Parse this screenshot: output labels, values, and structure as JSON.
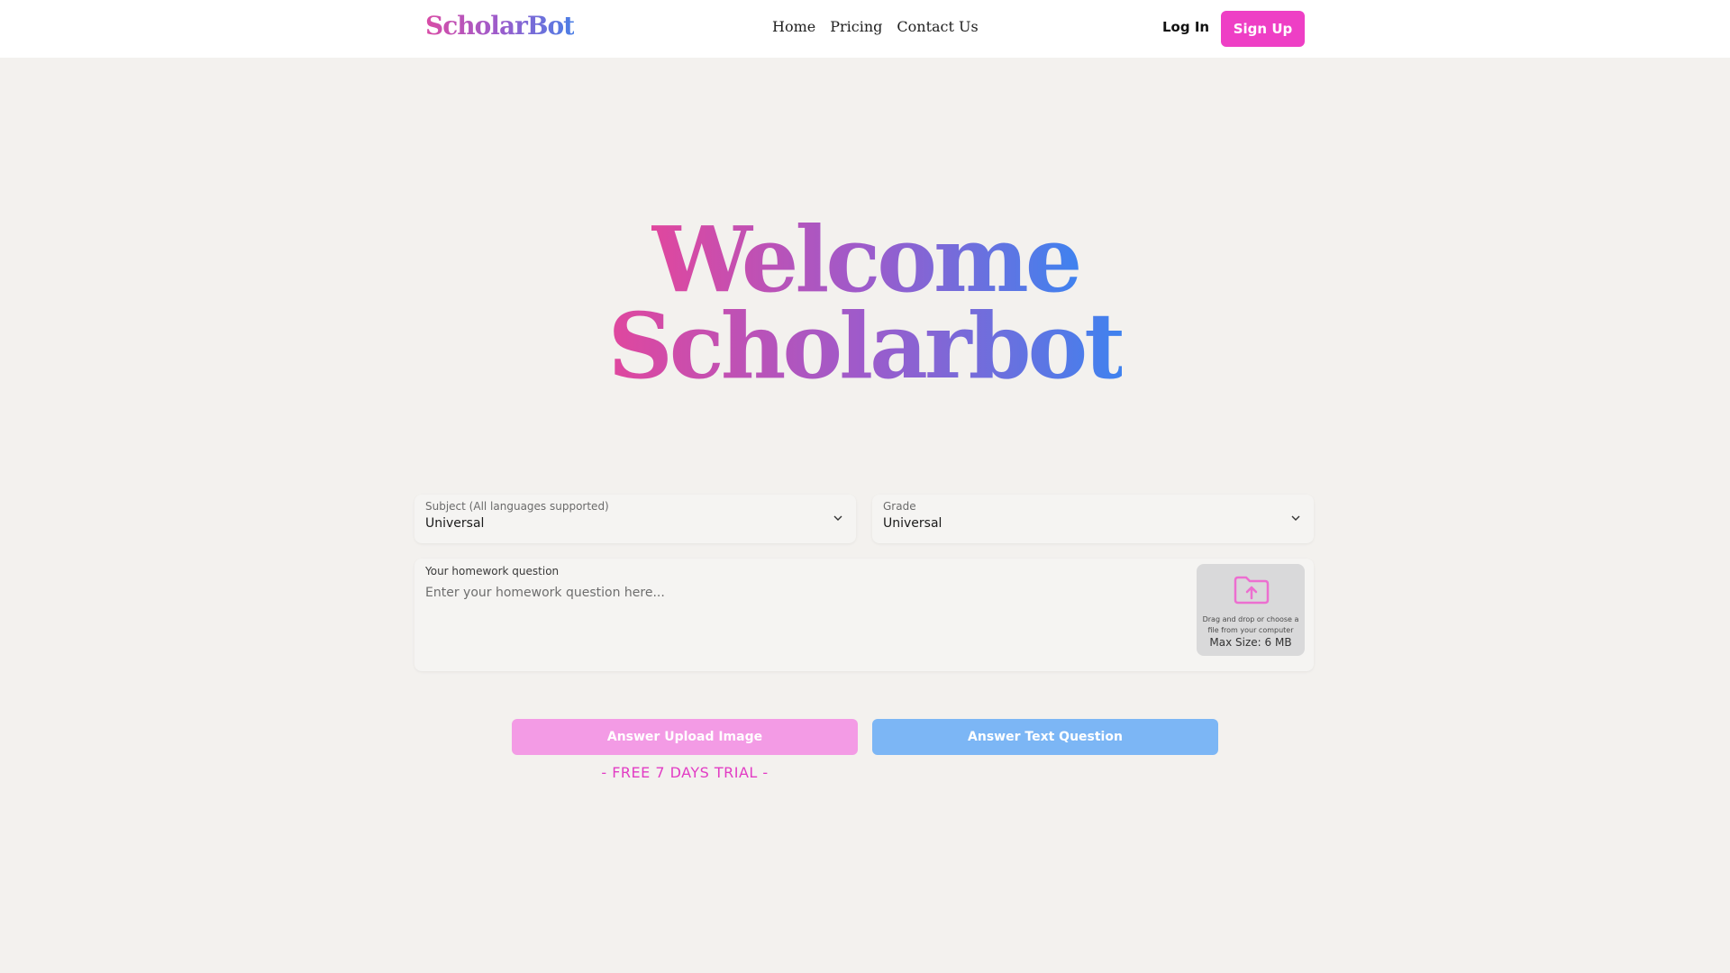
{
  "header": {
    "logo": "ScholarBot",
    "nav": [
      "Home",
      "Pricing",
      "Contact Us"
    ],
    "login_label": "Log In",
    "signup_label": "Sign Up"
  },
  "hero": {
    "line1": "Welcome",
    "line2": "Scholarbot"
  },
  "form": {
    "subject": {
      "label": "Subject (All languages supported)",
      "value": "Universal"
    },
    "grade": {
      "label": "Grade",
      "value": "Universal"
    },
    "question": {
      "label": "Your homework question",
      "placeholder": "Enter your homework question here..."
    },
    "upload": {
      "text": "Drag and drop or choose a file from your computer",
      "max_size": "Max Size: 6 MB",
      "icon": "folder-upload-icon"
    }
  },
  "actions": {
    "upload_image_label": "Answer Upload Image",
    "text_question_label": "Answer Text Question",
    "trial_text": "- FREE 7 DAYS TRIAL -"
  },
  "colors": {
    "accent_pink": "#ee3fc5",
    "upload_button": "#f39be5",
    "text_button": "#7cb6f5",
    "background": "#f3f1ee"
  }
}
